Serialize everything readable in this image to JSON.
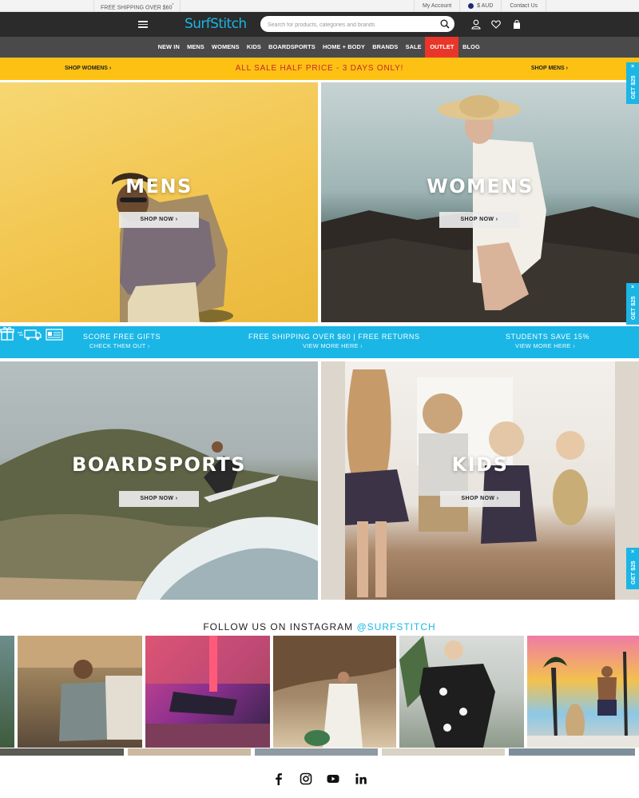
{
  "utility_bar": {
    "shipping_text": "FREE SHIPPING OVER $60",
    "shipping_mark": "*",
    "my_account": "My Account",
    "currency": "$ AUD",
    "contact": "Contact Us"
  },
  "header": {
    "logo": "SurfStitch",
    "search_placeholder": "Search for products, categories and brands",
    "icons": [
      "menu-icon",
      "search-icon",
      "user-icon",
      "heart-icon",
      "bag-icon"
    ]
  },
  "nav": {
    "items": [
      "NEW IN",
      "MENS",
      "WOMENS",
      "KIDS",
      "BOARDSPORTS",
      "HOME + BODY",
      "BRANDS",
      "SALE",
      "OUTLET",
      "BLOG"
    ],
    "highlight_color": "#e8362a"
  },
  "promo": {
    "left_link": "SHOP WOMENS",
    "center": "ALL SALE HALF PRICE - 3 DAYS ONLY!",
    "right_link": "SHOP MENS",
    "background": "#fdc114"
  },
  "tiles": [
    {
      "title": "MENS",
      "button": "SHOP NOW"
    },
    {
      "title": "WOMENS",
      "button": "SHOP NOW"
    },
    {
      "title": "BOARDSPORTS",
      "button": "SHOP NOW"
    },
    {
      "title": "KIDS",
      "button": "SHOP NOW"
    }
  ],
  "info_bar": {
    "items": [
      {
        "title": "SCORE FREE GIFTS",
        "link": "CHECK THEM OUT",
        "icon": "gift-icon"
      },
      {
        "title": "FREE SHIPPING OVER $60 | FREE RETURNS",
        "link": "VIEW MORE HERE",
        "icon": "truck-icon"
      },
      {
        "title": "STUDENTS SAVE 15%",
        "link": "VIEW MORE HERE",
        "icon": "student-card-icon"
      }
    ],
    "background": "#1ab6e6"
  },
  "side_tab": {
    "label": "GET $25",
    "close": "×"
  },
  "instagram": {
    "title": "FOLLOW US ON INSTAGRAM ",
    "handle": "@SURFSTITCH"
  },
  "social": [
    "facebook-icon",
    "instagram-icon",
    "youtube-icon",
    "linkedin-icon"
  ],
  "arrow": "›"
}
